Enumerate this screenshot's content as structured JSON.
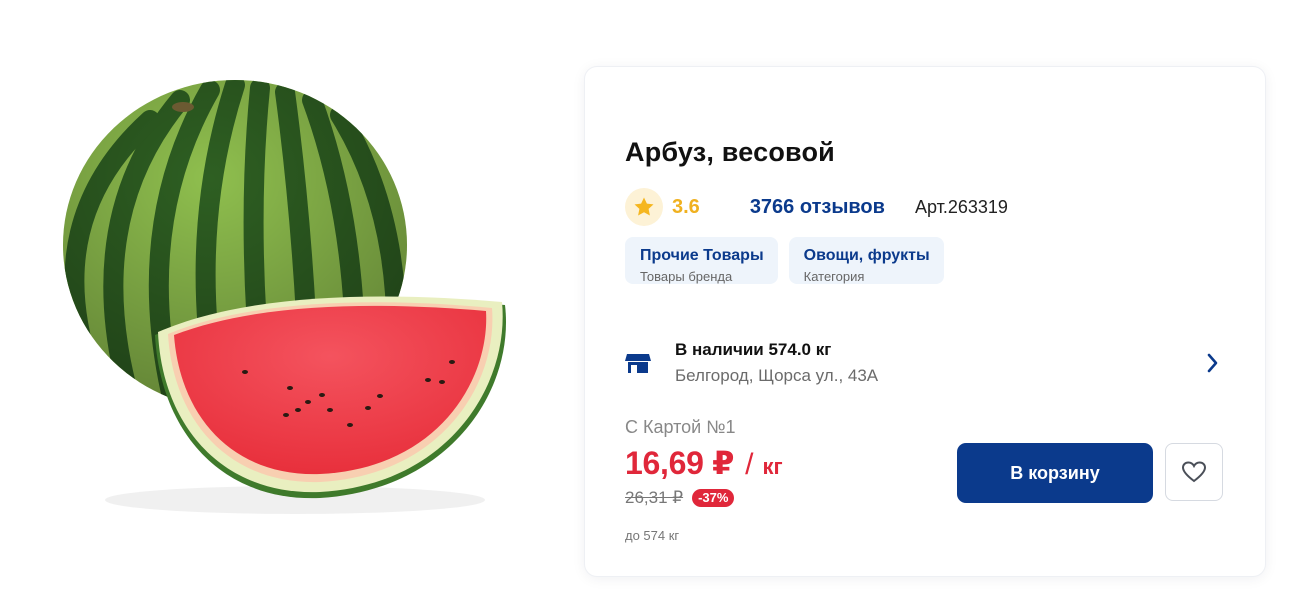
{
  "product": {
    "image_alt": "Арбуз",
    "title": "Арбуз, весовой",
    "rating": "3.6",
    "reviews": "3766 отзывов",
    "article": "Арт.263319",
    "tags": [
      {
        "title": "Прочие Товары",
        "subtitle": "Товары бренда"
      },
      {
        "title": "Овощи, фрукты",
        "subtitle": "Категория"
      }
    ],
    "availability": {
      "status": "В наличии 574.0 кг",
      "address": "Белгород, Щорса ул., 43А"
    },
    "pricing": {
      "card_label": "С Картой №1",
      "price": "16,69 ₽",
      "slash": "/",
      "unit": "кг",
      "old_price": "26,31 ₽",
      "discount": "-37%",
      "limit": "до 574 кг"
    },
    "actions": {
      "cart_label": "В корзину"
    }
  },
  "colors": {
    "accent_blue": "#0b3a8c",
    "price_red": "#e0273a",
    "rating_gold": "#f0b120",
    "tag_bg": "#eef4fb"
  },
  "icons": [
    "star-icon",
    "store-icon",
    "chevron-right-icon",
    "heart-icon"
  ]
}
